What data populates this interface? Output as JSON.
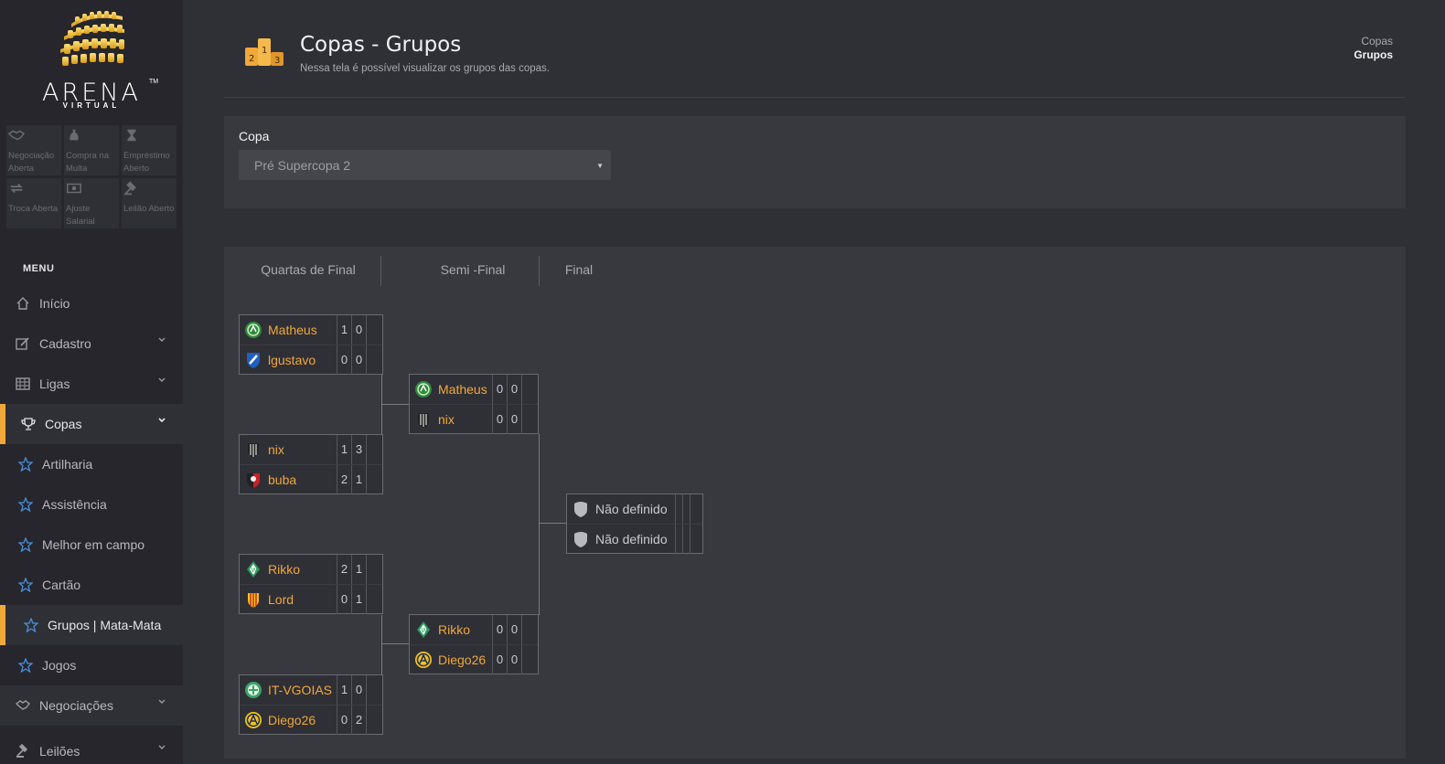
{
  "brand": {
    "name": "ARENA",
    "sub": "VIRTUAL",
    "tm": "TM"
  },
  "quick_actions": [
    {
      "icon": "handshake-icon",
      "label": "Negociação Aberta"
    },
    {
      "icon": "money-bag-icon",
      "label": "Compra na Multa"
    },
    {
      "icon": "hourglass-icon",
      "label": "Empréstimo Aberto"
    },
    {
      "icon": "swap-icon",
      "label": "Troca Aberta"
    },
    {
      "icon": "cash-icon",
      "label": "Ajuste Salarial"
    },
    {
      "icon": "gavel-icon",
      "label": "Leilão Aberto"
    }
  ],
  "menu": {
    "heading": "MENU",
    "items": [
      {
        "label": "Início",
        "icon": "home-icon"
      },
      {
        "label": "Cadastro",
        "icon": "edit-icon"
      },
      {
        "label": "Ligas",
        "icon": "table-icon"
      },
      {
        "label": "Copas",
        "icon": "trophy-icon"
      },
      {
        "label": "Artilharia",
        "icon": "star-icon"
      },
      {
        "label": "Assistência",
        "icon": "star-icon"
      },
      {
        "label": "Melhor em campo",
        "icon": "star-icon"
      },
      {
        "label": "Cartão",
        "icon": "star-icon"
      },
      {
        "label": "Grupos | Mata-Mata",
        "icon": "star-icon"
      },
      {
        "label": "Jogos",
        "icon": "star-icon"
      },
      {
        "label": "Negociações",
        "icon": "handshake-icon"
      },
      {
        "label": "Leilões",
        "icon": "gavel-icon"
      }
    ]
  },
  "header": {
    "title": "Copas - Grupos",
    "subtitle": "Nessa tela é possível visualizar os grupos das copas.",
    "breadcrumb": [
      "Copas",
      "Grupos"
    ]
  },
  "copa": {
    "label": "Copa",
    "selected": "Pré Supercopa 2"
  },
  "bracket": {
    "rounds": [
      "Quartas de Final",
      "Semi -Final",
      "Final"
    ],
    "quarter": [
      {
        "home": {
          "team": "Matheus",
          "s1": "1",
          "s2": "0"
        },
        "away": {
          "team": "lgustavo",
          "s1": "0",
          "s2": "0"
        }
      },
      {
        "home": {
          "team": "nix",
          "s1": "1",
          "s2": "3"
        },
        "away": {
          "team": "buba",
          "s1": "2",
          "s2": "1"
        }
      },
      {
        "home": {
          "team": "Rikko",
          "s1": "2",
          "s2": "1"
        },
        "away": {
          "team": "Lord",
          "s1": "0",
          "s2": "1"
        }
      },
      {
        "home": {
          "team": "IT-VGOIAS",
          "s1": "1",
          "s2": "0"
        },
        "away": {
          "team": "Diego26",
          "s1": "0",
          "s2": "2"
        }
      }
    ],
    "semi": [
      {
        "home": {
          "team": "Matheus",
          "s1": "0",
          "s2": "0"
        },
        "away": {
          "team": "nix",
          "s1": "0",
          "s2": "0"
        }
      },
      {
        "home": {
          "team": "Rikko",
          "s1": "0",
          "s2": "0"
        },
        "away": {
          "team": "Diego26",
          "s1": "0",
          "s2": "0"
        }
      }
    ],
    "final": {
      "home": {
        "team": "Não definido"
      },
      "away": {
        "team": "Não definido"
      }
    }
  },
  "colors": {
    "accent": "#f0a83a",
    "star": "#4a8fd8"
  }
}
